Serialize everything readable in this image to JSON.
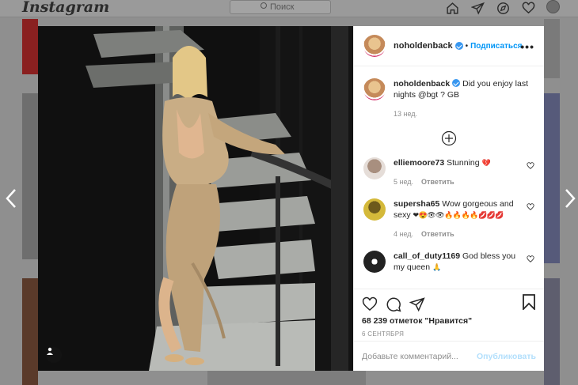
{
  "app": {
    "logo": "Instagram",
    "search_placeholder": "Поиск"
  },
  "nav_icons": [
    "home-icon",
    "direct-icon",
    "explore-icon",
    "activity-heart-icon",
    "profile-avatar"
  ],
  "post": {
    "author": "noholdenback",
    "follow_label": "Подписаться",
    "separator": "•",
    "more_label": "•••",
    "caption_user": "noholdenback",
    "caption_text": "Did you enjoy last nights @bgt ? GB",
    "caption_time": "13 нед.",
    "likes": "68 239 отметок \"Нравится\"",
    "date": "6 СЕНТЯБРЯ",
    "comment_placeholder": "Добавьте комментарий...",
    "post_label": "Опубликовать"
  },
  "comments": [
    {
      "user": "elliemoore73",
      "text": "Stunning",
      "emoji": "💔",
      "time": "5 нед.",
      "reply": "Ответить"
    },
    {
      "user": "supersha65",
      "text": "Wow gorgeous and sexy",
      "emoji": "❤😍👁👁🔥🔥🔥🔥💋💋💋",
      "time": "4 нед.",
      "reply": "Ответить"
    },
    {
      "user": "call_of_duty1169",
      "text": "God bless you my queen",
      "emoji": "🙏",
      "time": "",
      "reply": ""
    }
  ],
  "colors": {
    "accent": "#0095f6",
    "verified": "#3897f0",
    "muted": "#8e8e8e",
    "overlay": "#8f8f8f"
  }
}
